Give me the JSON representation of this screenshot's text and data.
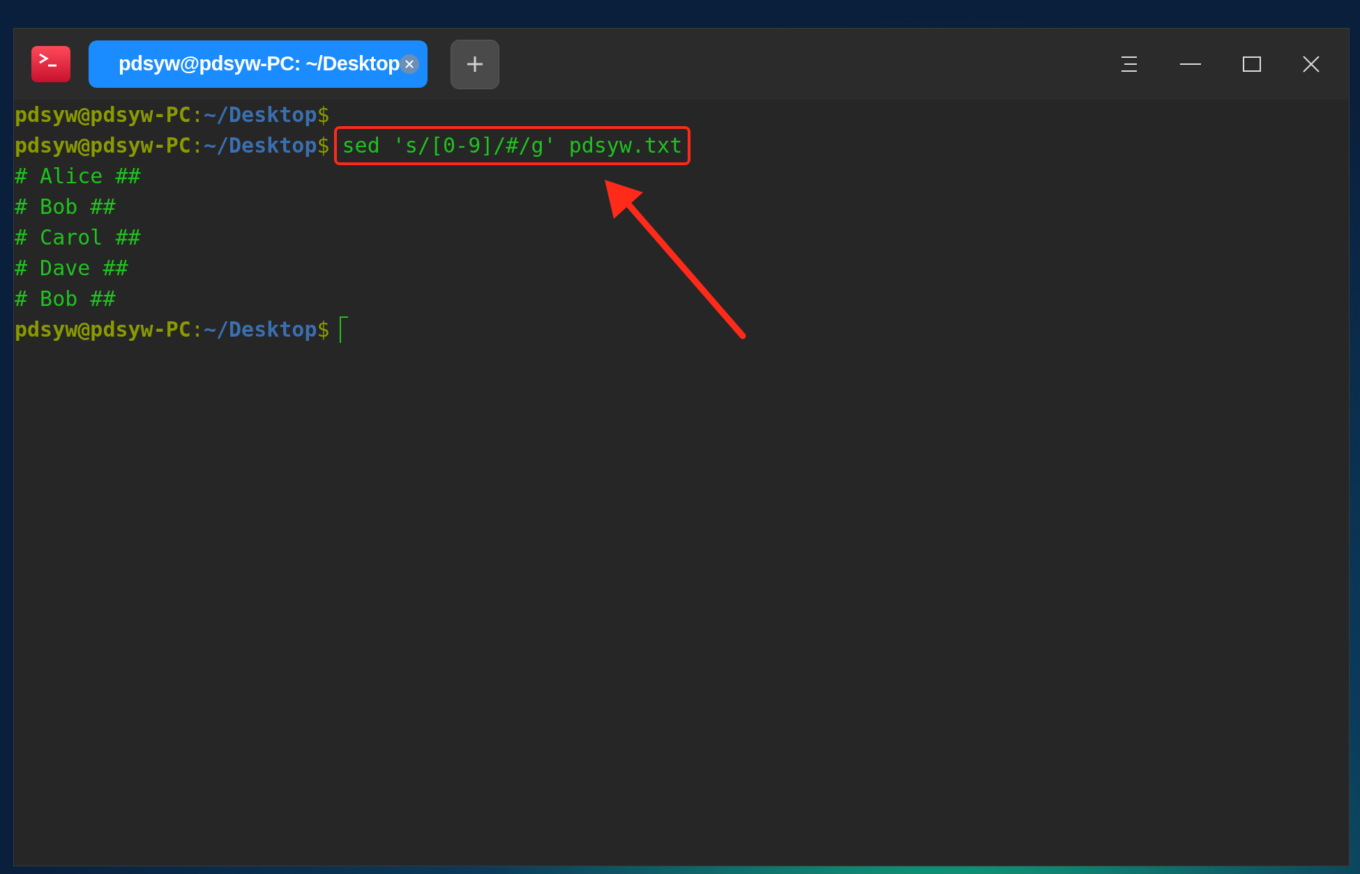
{
  "window": {
    "tabs": [
      {
        "label": "pdsyw@pdsyw-PC: ~/Desktop",
        "selected": true
      }
    ]
  },
  "terminal": {
    "lines": [
      {
        "kind": "prompt",
        "user": "pdsyw@pdsyw-PC",
        "separator": ":",
        "path": "~/Desktop",
        "symbol": "$",
        "highlighted": false,
        "cursor": false
      },
      {
        "kind": "prompt",
        "user": "pdsyw@pdsyw-PC",
        "separator": ":",
        "path": "~/Desktop",
        "symbol": "$",
        "command": "sed 's/[0-9]/#/g' pdsyw.txt",
        "highlighted": true,
        "cursor": false
      },
      {
        "kind": "output",
        "text": "# Alice ##"
      },
      {
        "kind": "output",
        "text": "# Bob ##"
      },
      {
        "kind": "output",
        "text": "# Carol ##"
      },
      {
        "kind": "output",
        "text": "# Dave ##"
      },
      {
        "kind": "output",
        "text": "# Bob ##"
      },
      {
        "kind": "prompt",
        "user": "pdsyw@pdsyw-PC",
        "separator": ":",
        "path": "~/Desktop",
        "symbol": "$",
        "highlighted": false,
        "cursor": true
      }
    ]
  }
}
